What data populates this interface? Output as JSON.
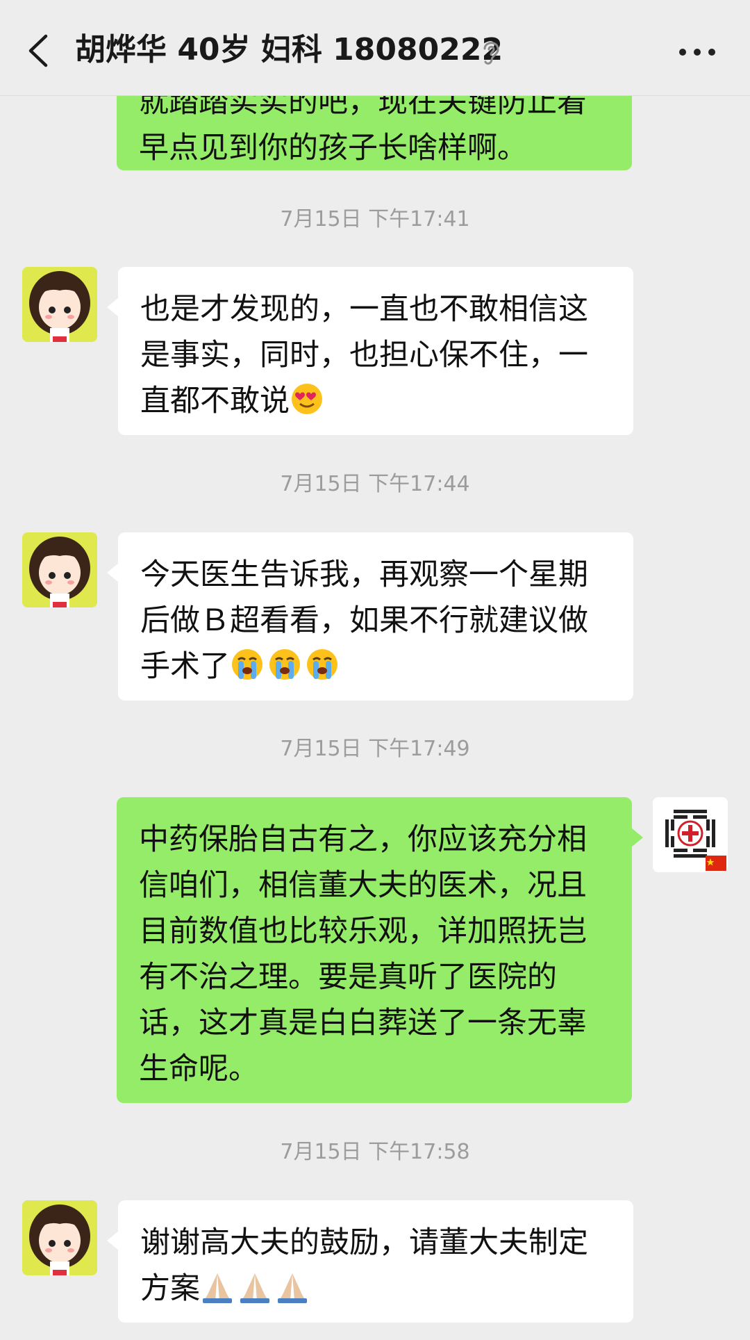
{
  "header": {
    "title": "胡烨华 40岁 妇科 18080222"
  },
  "messages": [
    {
      "sender": "me",
      "text": "早点见到你的孩子长啥样啊。",
      "partial_top": "就踏踏实实的吧，现在关键防止着"
    },
    {
      "timestamp": "7月15日 下午17:41"
    },
    {
      "sender": "patient",
      "lines": [
        "也是才发现的，一直也不敢相信这",
        "是事实，同时，也担心保不住，一",
        "直都不敢说"
      ],
      "emoji": "heart-eyes-emoji"
    },
    {
      "timestamp": "7月15日 下午17:44"
    },
    {
      "sender": "patient",
      "lines": [
        "今天医生告诉我，再观察一个星期",
        "后做Ｂ超看看，如果不行就建议做",
        "手术了"
      ],
      "emoji": "crying-emoji x3"
    },
    {
      "timestamp": "7月15日 下午17:49"
    },
    {
      "sender": "me",
      "lines": [
        "中药保胎自古有之，你应该充分相",
        "信咱们，相信董大夫的医术，况且",
        "目前数值也比较乐观，详加照抚岂",
        "有不治之理。要是真听了医院的",
        "话，这才真是白白葬送了一条无辜",
        "生命呢。"
      ]
    },
    {
      "timestamp": "7月15日 下午17:58"
    },
    {
      "sender": "patient",
      "lines": [
        "谢谢高大夫的鼓励，请董大夫制定",
        "方案"
      ],
      "emoji": "folded-hands-emoji x3"
    }
  ],
  "colors": {
    "background": "#ededed",
    "outgoing_bubble": "#95ec69",
    "incoming_bubble": "#ffffff",
    "timestamp_text": "#9c9c9c"
  }
}
